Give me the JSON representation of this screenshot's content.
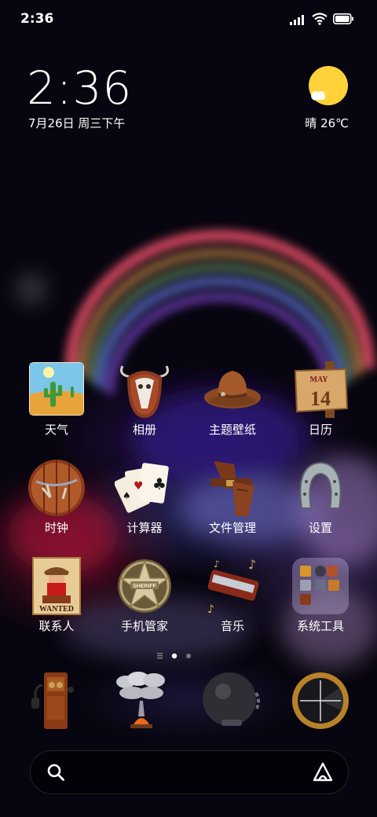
{
  "status": {
    "time": "2:36"
  },
  "lock_widget": {
    "clock": "2:36",
    "date": "7月26日 周三下午",
    "weather": "晴 26℃"
  },
  "apps_row1": [
    {
      "label": "天气",
      "icon": "desert-cactus-icon"
    },
    {
      "label": "相册",
      "icon": "bull-skull-icon"
    },
    {
      "label": "主题壁纸",
      "icon": "cowboy-hat-icon"
    },
    {
      "label": "日历",
      "icon": "calendar-sign-icon"
    }
  ],
  "apps_row2": [
    {
      "label": "时钟",
      "icon": "wooden-barrel-clock-icon"
    },
    {
      "label": "计算器",
      "icon": "playing-cards-icon"
    },
    {
      "label": "文件管理",
      "icon": "holster-icon"
    },
    {
      "label": "设置",
      "icon": "horseshoe-icon"
    }
  ],
  "apps_row3": [
    {
      "label": "联系人",
      "icon": "wanted-poster-icon"
    },
    {
      "label": "手机管家",
      "icon": "sheriff-badge-icon"
    },
    {
      "label": "音乐",
      "icon": "harmonica-icon"
    },
    {
      "label": "系统工具",
      "icon": "folder-icon"
    }
  ],
  "calendar_icon": {
    "month": "MAY",
    "day": "14"
  },
  "sheriff_text": "SHERIFF",
  "wanted_text": "WANTED",
  "dock": [
    {
      "icon": "antique-telephone-icon"
    },
    {
      "icon": "campfire-smoke-icon"
    },
    {
      "icon": "ball-and-chain-icon"
    },
    {
      "icon": "scope-crosshair-icon"
    }
  ],
  "page_indicator": {
    "pages": 2,
    "current": 1
  },
  "colors": {
    "sun": "#ffd23a",
    "accent": "#ffffff"
  }
}
